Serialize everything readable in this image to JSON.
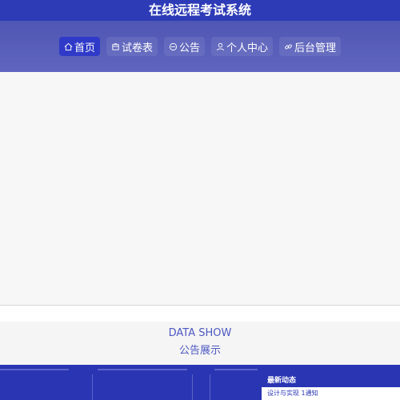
{
  "header": {
    "title": "在线远程考试系统"
  },
  "nav": {
    "items": [
      {
        "label": "首页",
        "icon": "home-icon",
        "active": true
      },
      {
        "label": "试卷表",
        "icon": "paper-icon",
        "active": false
      },
      {
        "label": "公告",
        "icon": "announcement-icon",
        "active": false
      },
      {
        "label": "个人中心",
        "icon": "user-icon",
        "active": false
      },
      {
        "label": "后台管理",
        "icon": "link-icon",
        "active": false
      }
    ]
  },
  "section": {
    "title_en": "DATA SHOW",
    "title_cn": "公告展示"
  },
  "news": {
    "title": "最新动态",
    "items": [
      "设计与实现 1通知"
    ]
  }
}
